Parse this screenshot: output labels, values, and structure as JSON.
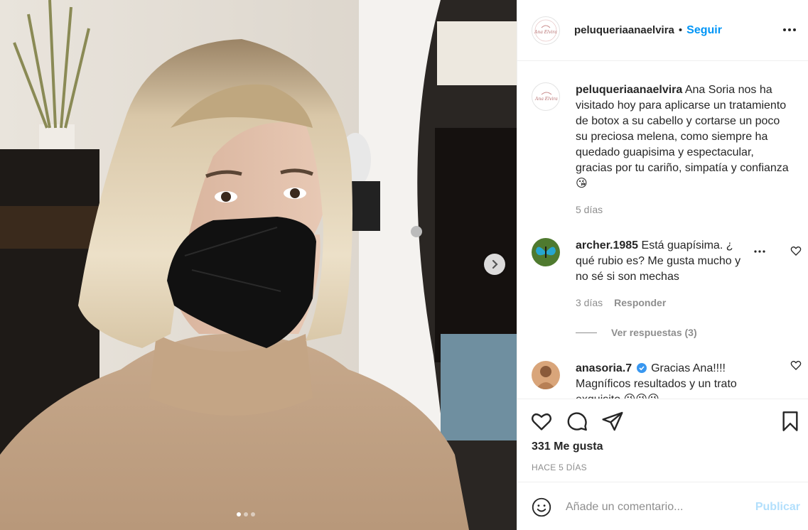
{
  "post": {
    "username": "peluqueriaanaelvira",
    "follow_label": "Seguir",
    "separator": "•",
    "logo_text": "Ana Elvira",
    "caption": "Ana Soria nos ha visitado hoy para aplicarse un tratamiento de botox a su cabello y cortarse un poco su preciosa melena, como siempre ha quedado guapisima y espectacular, gracias por tu cariño, simpatía y confianza 😘",
    "caption_time": "5 días",
    "likes": "331 Me gusta",
    "time_ago": "HACE 5 DÍAS",
    "carousel": {
      "total": 3,
      "active": 0
    }
  },
  "comments": [
    {
      "username": "archer.1985",
      "text": "Está guapísima. ¿ qué rubio es? Me gusta mucho y no sé si son mechas",
      "time": "3 días",
      "reply_label": "Responder",
      "view_replies": "Ver respuestas (3)"
    },
    {
      "username": "anasoria.7",
      "verified": true,
      "text": "Gracias Ana!!!! Magníficos resultados y un trato exquisito 😘😘😘"
    }
  ],
  "add_comment": {
    "placeholder": "Añade un comentario...",
    "post_label": "Publicar"
  },
  "colors": {
    "link_blue": "#0095f6",
    "post_disabled": "#b2dffc",
    "muted": "#8e8e8e",
    "border": "#efefef"
  }
}
